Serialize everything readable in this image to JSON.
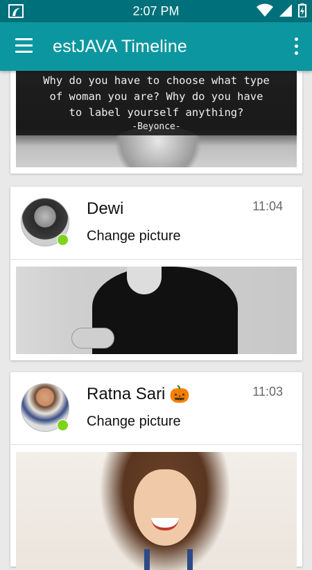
{
  "status_bar": {
    "time": "2:07 PM"
  },
  "app_bar": {
    "title": "estJAVA Timeline",
    "menu_icon": "menu-icon",
    "overflow_icon": "more-vert-icon"
  },
  "colors": {
    "status_bar": "#00707a",
    "app_bar": "#0c97a0",
    "online": "#7ed321"
  },
  "feed": {
    "quote_card": {
      "quote_lines": [
        "Why do you have to choose what type",
        "of woman you are? Why do you have",
        "to label yourself anything?"
      ],
      "attribution": "-Beyonce-"
    },
    "posts": [
      {
        "user": "Dewi",
        "time": "11:04",
        "text": "Change picture",
        "online": true
      },
      {
        "user": "Ratna Sari",
        "emoji": "🎃",
        "time": "11:03",
        "text": "Change picture",
        "online": true
      }
    ]
  }
}
